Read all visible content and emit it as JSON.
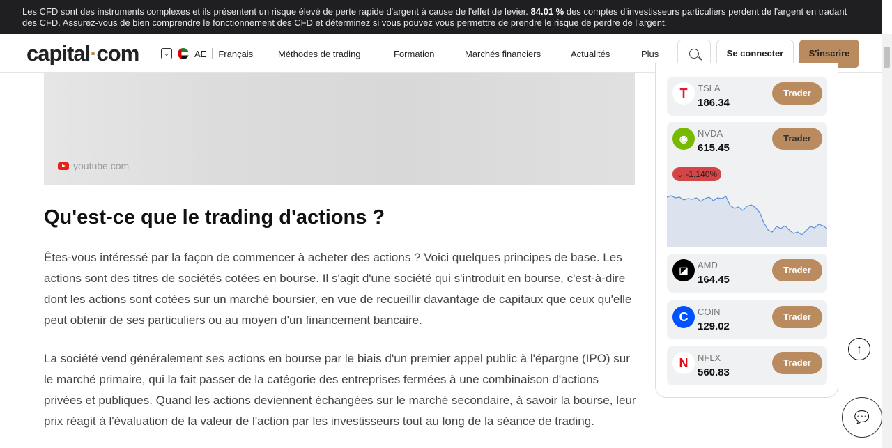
{
  "banner": {
    "text_before": "Les CFD sont des instruments complexes et ils présentent un risque élevé de perte rapide d'argent à cause de l'effet de levier. ",
    "percent": "84.01 %",
    "text_after": " des comptes d'investisseurs particuliers perdent de l'argent en tradant des CFD. Assurez-vous de bien comprendre le fonctionnement des CFD et déterminez si vous pouvez vous permettre de prendre le risque de perdre de l'argent."
  },
  "header": {
    "logo_a": "capital",
    "logo_dot": "·",
    "logo_b": "com",
    "region": "AE",
    "language": "Français",
    "nav": [
      "Méthodes de trading",
      "Formation",
      "Marchés financiers",
      "Actualités",
      "Plus"
    ],
    "login": "Se connecter",
    "signup": "S'inscrire"
  },
  "video": {
    "source": "youtube.com"
  },
  "article": {
    "heading": "Qu'est-ce que le trading d'actions ?",
    "paragraphs": [
      "Êtes-vous intéressé par la façon de commencer à acheter des actions ? Voici quelques principes de base. Les actions sont des titres de sociétés cotées en bourse. Il s'agit d'une société qui s'introduit en bourse, c'est-à-dire dont les actions sont cotées sur un marché boursier, en vue de recueillir davantage de capitaux que ceux qu'elle peut obtenir de ses particuliers ou au moyen d'un financement bancaire.",
      "La société vend généralement ses actions en bourse par le biais d'un premier appel public à l'épargne (IPO) sur le marché primaire, qui la fait passer de la catégorie des entreprises fermées à une combinaison d'actions privées et publiques. Quand les actions deviennent échangées sur le marché secondaire, à savoir la bourse, leur prix réagit à l'évaluation de la valeur de l'action par les investisseurs tout au long de la séance de trading."
    ]
  },
  "stocks": [
    {
      "symbol": "TSLA",
      "price": "186.34",
      "button": "Trader",
      "icon": "tesla-logo"
    },
    {
      "symbol": "NVDA",
      "price": "615.45",
      "button": "Trader",
      "icon": "nvidia-logo",
      "change": "-1.140%",
      "change_color": "#d64545"
    },
    {
      "symbol": "AMD",
      "price": "164.45",
      "button": "Trader",
      "icon": "amd-logo"
    },
    {
      "symbol": "COIN",
      "price": "129.02",
      "button": "Trader",
      "icon": "coinbase-logo"
    },
    {
      "symbol": "NFLX",
      "price": "560.83",
      "button": "Trader",
      "icon": "netflix-logo"
    }
  ],
  "colors": {
    "accent": "#b98b5e",
    "banner_bg": "#1f1f21",
    "negative": "#d64545"
  }
}
